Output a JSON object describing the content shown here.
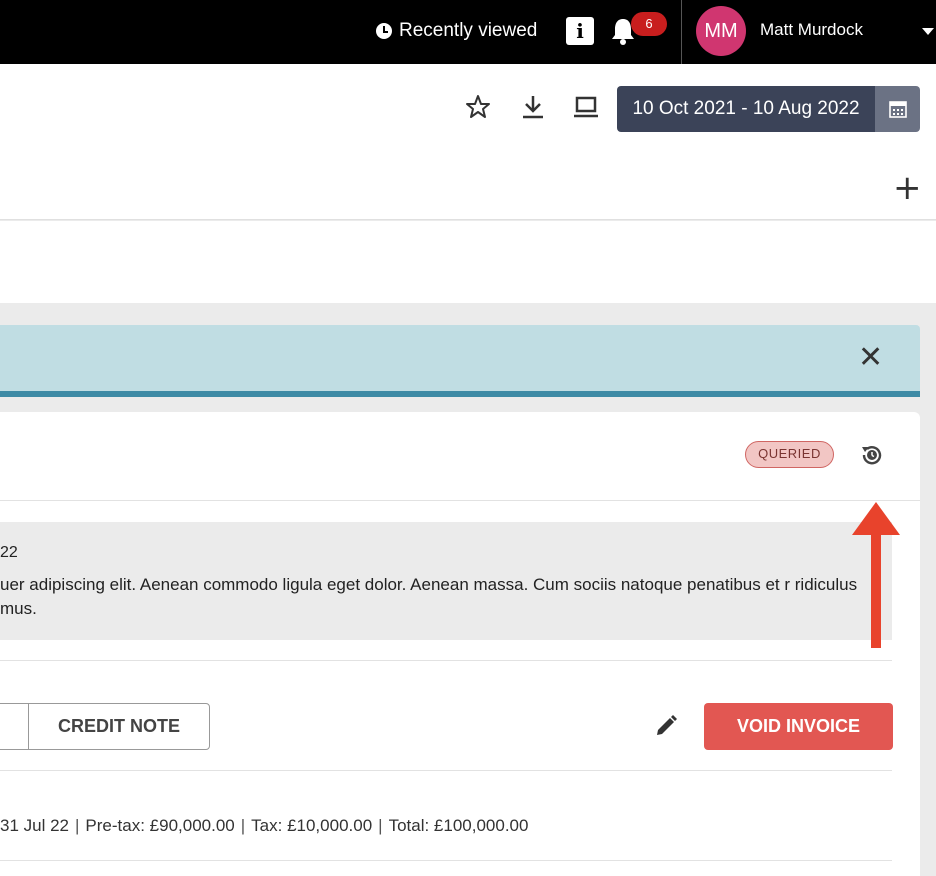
{
  "topbar": {
    "recently_viewed": "Recently viewed",
    "info_label": "i",
    "notification_count": "6",
    "avatar_initials": "MM",
    "user_name": "Matt Murdock"
  },
  "toolbar": {
    "date_range": "10 Oct 2021 - 10 Aug 2022"
  },
  "invoice": {
    "status_badge": "QUERIED",
    "note_date": "22",
    "note_text": "uer adipiscing elit. Aenean commodo ligula eget dolor. Aenean massa. Cum sociis natoque penatibus et r ridiculus mus.",
    "credit_note_label": "CREDIT NOTE",
    "void_label": "VOID INVOICE",
    "summary": {
      "date": "31 Jul 22",
      "pretax": "Pre-tax: £90,000.00",
      "tax": "Tax: £10,000.00",
      "total": "Total: £100,000.00"
    }
  },
  "colors": {
    "accent_dark": "#3b4358",
    "danger": "#e25752",
    "banner_bg": "#c0dde3",
    "banner_border": "#3d8aa5",
    "avatar": "#d03670",
    "annotation_arrow": "#e8432c"
  },
  "icons": {
    "recently_viewed": "clock-icon",
    "bell": "bell-icon",
    "favorite": "star-icon",
    "download": "download-icon",
    "present": "laptop-icon",
    "calendar": "calendar-icon",
    "add": "plus-icon",
    "close": "close-icon",
    "history": "history-icon",
    "edit": "pencil-icon"
  }
}
